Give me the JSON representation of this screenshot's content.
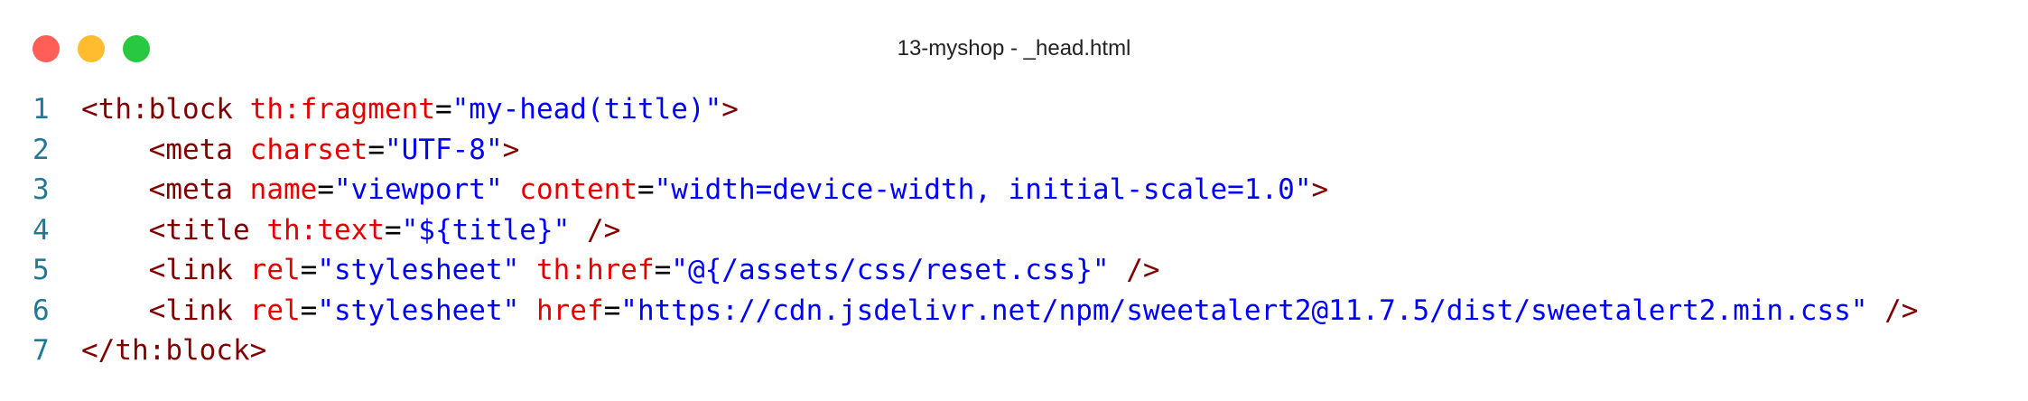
{
  "window": {
    "title": "13-myshop - _head.html",
    "controls": [
      "close",
      "minimize",
      "maximize"
    ]
  },
  "colors": {
    "line_number": "#237893",
    "tag": "#800000",
    "attribute": "#e50000",
    "punctuation": "#000000",
    "value": "#0000ff"
  },
  "editor": {
    "lines": [
      {
        "number": "1",
        "tokens": [
          {
            "t": "tag",
            "text": "<th:block"
          },
          {
            "t": "punct",
            "text": " "
          },
          {
            "t": "attr",
            "text": "th:fragment"
          },
          {
            "t": "punct",
            "text": "="
          },
          {
            "t": "val",
            "text": "\"my-head(title)\""
          },
          {
            "t": "tag",
            "text": ">"
          }
        ]
      },
      {
        "number": "2",
        "tokens": [
          {
            "t": "punct",
            "text": "    "
          },
          {
            "t": "tag",
            "text": "<meta"
          },
          {
            "t": "punct",
            "text": " "
          },
          {
            "t": "attr",
            "text": "charset"
          },
          {
            "t": "punct",
            "text": "="
          },
          {
            "t": "val",
            "text": "\"UTF-8\""
          },
          {
            "t": "tag",
            "text": ">"
          }
        ]
      },
      {
        "number": "3",
        "tokens": [
          {
            "t": "punct",
            "text": "    "
          },
          {
            "t": "tag",
            "text": "<meta"
          },
          {
            "t": "punct",
            "text": " "
          },
          {
            "t": "attr",
            "text": "name"
          },
          {
            "t": "punct",
            "text": "="
          },
          {
            "t": "val",
            "text": "\"viewport\""
          },
          {
            "t": "punct",
            "text": " "
          },
          {
            "t": "attr",
            "text": "content"
          },
          {
            "t": "punct",
            "text": "="
          },
          {
            "t": "val",
            "text": "\"width=device-width, initial-scale=1.0\""
          },
          {
            "t": "tag",
            "text": ">"
          }
        ]
      },
      {
        "number": "4",
        "tokens": [
          {
            "t": "punct",
            "text": "    "
          },
          {
            "t": "tag",
            "text": "<title"
          },
          {
            "t": "punct",
            "text": " "
          },
          {
            "t": "attr",
            "text": "th:text"
          },
          {
            "t": "punct",
            "text": "="
          },
          {
            "t": "val",
            "text": "\"${title}\""
          },
          {
            "t": "punct",
            "text": " "
          },
          {
            "t": "tag",
            "text": "/>"
          }
        ]
      },
      {
        "number": "5",
        "tokens": [
          {
            "t": "punct",
            "text": "    "
          },
          {
            "t": "tag",
            "text": "<link"
          },
          {
            "t": "punct",
            "text": " "
          },
          {
            "t": "attr",
            "text": "rel"
          },
          {
            "t": "punct",
            "text": "="
          },
          {
            "t": "val",
            "text": "\"stylesheet\""
          },
          {
            "t": "punct",
            "text": " "
          },
          {
            "t": "attr",
            "text": "th:href"
          },
          {
            "t": "punct",
            "text": "="
          },
          {
            "t": "val",
            "text": "\"@{/assets/css/reset.css}\""
          },
          {
            "t": "punct",
            "text": " "
          },
          {
            "t": "tag",
            "text": "/>"
          }
        ]
      },
      {
        "number": "6",
        "tokens": [
          {
            "t": "punct",
            "text": "    "
          },
          {
            "t": "tag",
            "text": "<link"
          },
          {
            "t": "punct",
            "text": " "
          },
          {
            "t": "attr",
            "text": "rel"
          },
          {
            "t": "punct",
            "text": "="
          },
          {
            "t": "val",
            "text": "\"stylesheet\""
          },
          {
            "t": "punct",
            "text": " "
          },
          {
            "t": "attr",
            "text": "href"
          },
          {
            "t": "punct",
            "text": "="
          },
          {
            "t": "val",
            "text": "\"https://cdn.jsdelivr.net/npm/sweetalert2@11.7.5/dist/sweetalert2.min.css\""
          },
          {
            "t": "punct",
            "text": " "
          },
          {
            "t": "tag",
            "text": "/>"
          }
        ]
      },
      {
        "number": "7",
        "tokens": [
          {
            "t": "tag",
            "text": "</th:block>"
          }
        ]
      }
    ]
  }
}
